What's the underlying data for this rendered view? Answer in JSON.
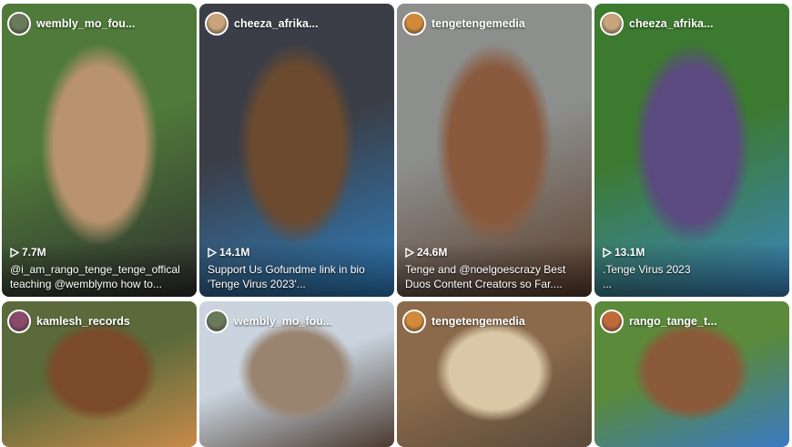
{
  "videos": [
    {
      "username": "wembly_mo_fou...",
      "views": "7.7M",
      "caption_line1": "@i_am_rango_tenge_tenge_offical",
      "caption_line2": "teaching @wemblymo how to...",
      "avatar_color": "#6b7a5a",
      "bg": [
        "#4f7a3a",
        "#b9926f",
        "#2f2f2f"
      ]
    },
    {
      "username": "cheeza_afrika...",
      "views": "14.1M",
      "caption_line1": "Support Us Gofundme link in bio",
      "caption_line2": "'Tenge Virus 2023'...",
      "avatar_color": "#c9a47a",
      "bg": [
        "#3b3e47",
        "#6b4a2f",
        "#2f7fbf"
      ]
    },
    {
      "username": "tengetengemedia",
      "views": "24.6M",
      "caption_line1": "Tenge and @noelgoescrazy Best",
      "caption_line2": "Duos Content Creators so Far....",
      "avatar_color": "#d08a3a",
      "bg": [
        "#8d8f8d",
        "#8a5a3e",
        "#5a3d2b"
      ]
    },
    {
      "username": "cheeza_afrika...",
      "views": "13.1M",
      "caption_line1": ".Tenge Virus 2023",
      "caption_line2": "...",
      "avatar_color": "#c9a47a",
      "bg": [
        "#3c7a2f",
        "#5b4a7f",
        "#3a86c4"
      ]
    },
    {
      "username": "kamlesh_records",
      "views": "",
      "caption_line1": "",
      "caption_line2": "",
      "avatar_color": "#8a4a6a",
      "bg": [
        "#5a6a3a",
        "#7a4a2a",
        "#c88a4a"
      ]
    },
    {
      "username": "wembly_mo_fou...",
      "views": "",
      "caption_line1": "",
      "caption_line2": "",
      "avatar_color": "#6b7a5a",
      "bg": [
        "#c9d4df",
        "#9a8470",
        "#4a3a2f"
      ]
    },
    {
      "username": "tengetengemedia",
      "views": "",
      "caption_line1": "",
      "caption_line2": "",
      "avatar_color": "#d08a3a",
      "bg": [
        "#8a6a4a",
        "#d9c7a6",
        "#5a4a3a"
      ]
    },
    {
      "username": "rango_tange_t...",
      "views": "",
      "caption_line1": "",
      "caption_line2": "",
      "avatar_color": "#c06a3a",
      "bg": [
        "#5a8a3a",
        "#8a5a3a",
        "#3a7ac4"
      ]
    }
  ]
}
